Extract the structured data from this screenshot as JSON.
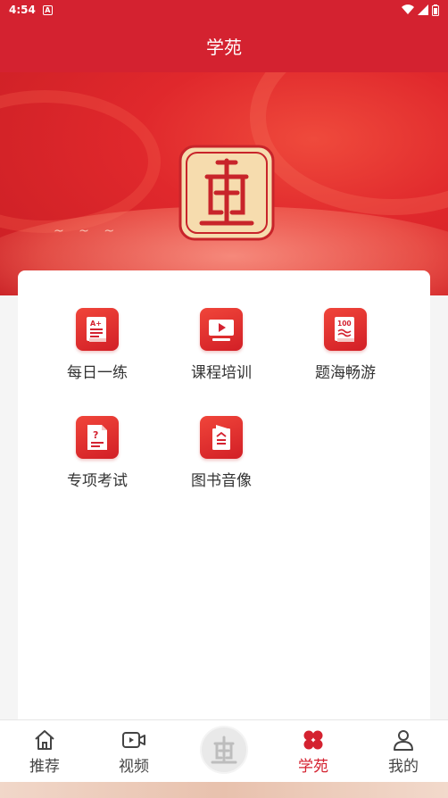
{
  "status": {
    "time": "4:54",
    "badge": "A"
  },
  "header": {
    "title": "学苑"
  },
  "colors": {
    "brand_red": "#d42230",
    "logo_bg": "#f6dcae"
  },
  "grid": [
    {
      "label": "每日一练",
      "icon": "daily-practice-icon"
    },
    {
      "label": "课程培训",
      "icon": "video-course-icon"
    },
    {
      "label": "题海畅游",
      "icon": "question-bank-icon"
    },
    {
      "label": "专项考试",
      "icon": "exam-icon"
    },
    {
      "label": "图书音像",
      "icon": "book-audio-icon"
    }
  ],
  "tabs": [
    {
      "label": "推荐",
      "icon": "home-icon"
    },
    {
      "label": "视频",
      "icon": "video-icon"
    },
    {
      "label": "",
      "icon": "center-logo-icon"
    },
    {
      "label": "学苑",
      "icon": "clover-icon",
      "active": true
    },
    {
      "label": "我的",
      "icon": "person-icon"
    }
  ]
}
